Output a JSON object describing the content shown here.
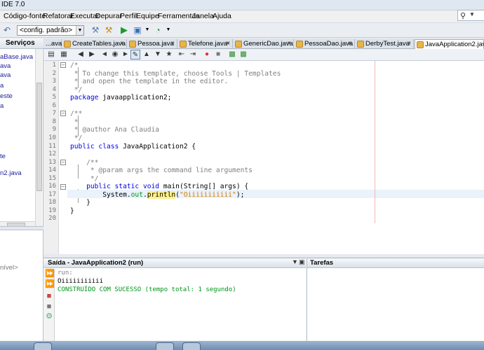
{
  "window": {
    "title": "IDE 7.0"
  },
  "menu": [
    "Código-fonte",
    "Refatorar",
    "Executar",
    "Depurar",
    "Perfil",
    "Equipe",
    "Ferramentas",
    "Janela",
    "Ajuda"
  ],
  "toolbar": {
    "config_value": "<config. padrão>"
  },
  "left_panel": {
    "title": "Serviços",
    "items": [
      "aBase.java",
      "ava",
      "ava",
      "a",
      "este",
      "a",
      "te",
      "n2.java"
    ],
    "status": "nível>"
  },
  "tabs": [
    {
      "label": "...ava",
      "active": false
    },
    {
      "label": "CreateTables.java",
      "active": false
    },
    {
      "label": "Pessoa.java",
      "active": false
    },
    {
      "label": "Telefone.java",
      "active": false
    },
    {
      "label": "GenericDao.java",
      "active": false
    },
    {
      "label": "PessoaDao.java",
      "active": false
    },
    {
      "label": "DerbyTest.java",
      "active": false
    },
    {
      "label": "JavaApplication2.java",
      "active": true
    }
  ],
  "editor": {
    "line_numbers": [
      "1",
      "2",
      "3",
      "4",
      "5",
      "6",
      "7",
      "8",
      "9",
      "10",
      "11",
      "12",
      "13",
      "14",
      "15",
      "16",
      "17",
      "18",
      "19",
      "20"
    ],
    "code": [
      [
        {
          "t": "/*",
          "c": "com"
        }
      ],
      [
        {
          "t": " * To change this template, choose Tools | Templates",
          "c": "com"
        }
      ],
      [
        {
          "t": " * and open the template in the editor.",
          "c": "com"
        }
      ],
      [
        {
          "t": " */",
          "c": "com"
        }
      ],
      [
        {
          "t": "package",
          "c": "kw"
        },
        {
          "t": " javaapplication2;",
          "c": "plain"
        }
      ],
      [],
      [
        {
          "t": "/**",
          "c": "com"
        }
      ],
      [
        {
          "t": " *",
          "c": "com"
        }
      ],
      [
        {
          "t": " * @author Ana Claudia",
          "c": "com"
        }
      ],
      [
        {
          "t": " */",
          "c": "com"
        }
      ],
      [
        {
          "t": "public class",
          "c": "kw"
        },
        {
          "t": " JavaApplication2 {",
          "c": "plain"
        }
      ],
      [],
      [
        {
          "t": "    /**",
          "c": "com"
        }
      ],
      [
        {
          "t": "     * @param args the command line arguments",
          "c": "com"
        }
      ],
      [
        {
          "t": "     */",
          "c": "com"
        }
      ],
      [
        {
          "t": "    public static void",
          "c": "kw"
        },
        {
          "t": " main(String[] args) {",
          "c": "plain"
        }
      ],
      [
        {
          "t": "        System.",
          "c": "plain"
        },
        {
          "t": "out",
          "c": "fld"
        },
        {
          "t": ".",
          "c": "plain"
        },
        {
          "t": "println",
          "c": "hl"
        },
        {
          "t": "(",
          "c": "plain"
        },
        {
          "t": "\"Oiiiiiiiiiii\"",
          "c": "str"
        },
        {
          "t": ");",
          "c": "plain"
        }
      ],
      [
        {
          "t": "    }",
          "c": "plain"
        }
      ],
      [
        {
          "t": "}",
          "c": "plain"
        }
      ],
      []
    ]
  },
  "output": {
    "title": "Saída - JavaApplication2 (run)",
    "lines": [
      {
        "t": "run:",
        "c": "#808080"
      },
      {
        "t": "Oiiiiiiiiiii",
        "c": "#000000"
      },
      {
        "t": "CONSTRUÍDO COM SUCESSO (tempo total: 1 segundo)",
        "c": "#009619"
      }
    ]
  },
  "tasks": {
    "title": "Tarefas"
  }
}
